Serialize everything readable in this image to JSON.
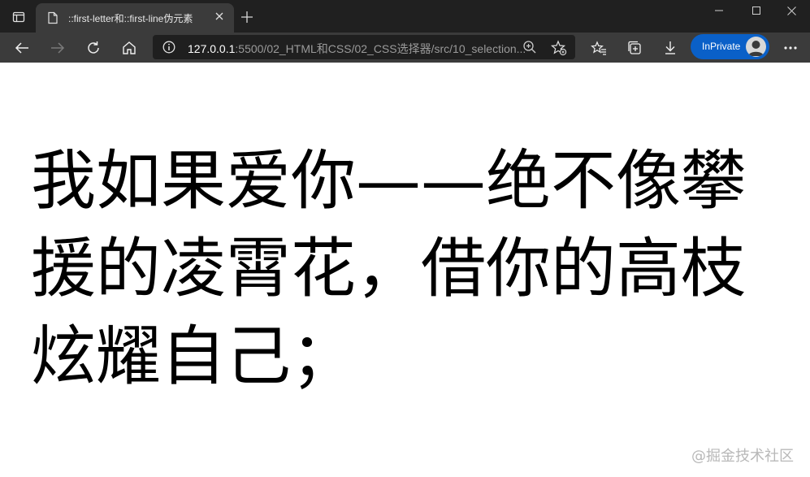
{
  "browser": {
    "tab": {
      "title": "::first-letter和::first-line伪元素"
    },
    "address": {
      "host": "127.0.0.1",
      "path": ":5500/02_HTML和CSS/02_CSS选择器/src/10_selection..."
    },
    "inprivate_label": "InPrivate",
    "icons": {
      "tab_actions": "tab-actions-icon",
      "page": "page-icon",
      "close": "close-icon",
      "new_tab": "plus-icon",
      "back": "back-arrow-icon",
      "forward": "forward-arrow-icon",
      "refresh": "refresh-icon",
      "home": "home-icon",
      "info": "info-icon",
      "zoom": "zoom-icon",
      "add_favorite": "add-favorite-icon",
      "favorites": "favorites-icon",
      "collections": "collections-icon",
      "downloads": "download-icon",
      "more": "more-icon"
    },
    "colors": {
      "inprivate": "#0a60c8",
      "titlebar": "#202020",
      "toolbar": "#3b3b3b"
    }
  },
  "page": {
    "text": "我如果爱你——绝不像攀援的凌霄花，借你的高枝炫耀自己；"
  },
  "watermark": "@掘金技术社区"
}
